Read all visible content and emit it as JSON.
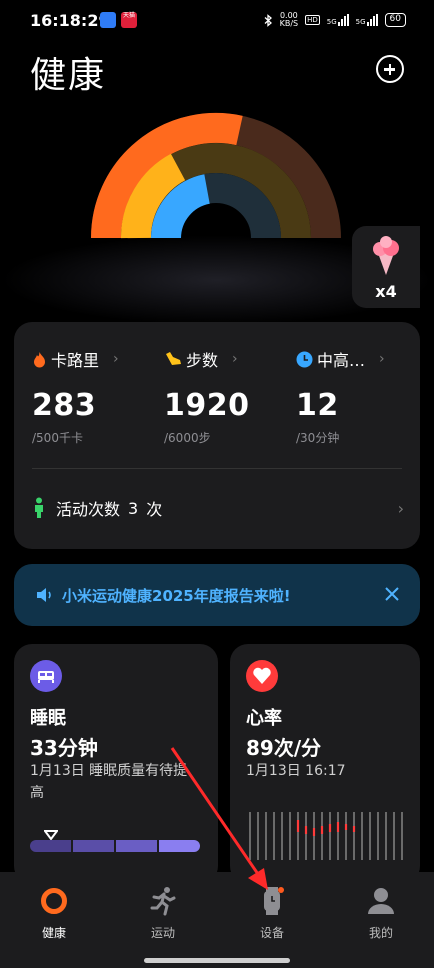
{
  "status_bar": {
    "time": "16:18:29",
    "net_speed_value": "0.00",
    "net_speed_unit": "KB/S",
    "hd_label": "HD",
    "signal_label_1": "5G",
    "signal_label_2": "5G",
    "battery": "60",
    "app2_badge": "天猫"
  },
  "header": {
    "title": "健康"
  },
  "activity_badge": {
    "count": "x4"
  },
  "summary": {
    "metrics": [
      {
        "label": "卡路里",
        "value": "283",
        "target": "/500千卡",
        "icon": "flame-icon",
        "color": "#ff6a1e"
      },
      {
        "label": "步数",
        "value": "1920",
        "target": "/6000步",
        "icon": "shoe-icon",
        "color": "#ffc21a"
      },
      {
        "label": "中高…",
        "value": "12",
        "target": "/30分钟",
        "icon": "clock-icon",
        "color": "#38a7ff"
      }
    ],
    "activity": {
      "label": "活动次数",
      "count": "3",
      "unit": "次"
    }
  },
  "banner": {
    "text": "小米运动健康2025年度报告来啦!",
    "icon": "speaker-icon",
    "color": "#4fb3ff"
  },
  "sleep": {
    "title": "睡眠",
    "value": "33分钟",
    "subtitle": "1月13日 睡眠质量有待提高",
    "icon": "bed-icon",
    "color": "#6c5ce7"
  },
  "heart_rate": {
    "title": "心率",
    "value": "89次/分",
    "subtitle": "1月13日 16:17",
    "icon": "heart-icon",
    "color": "#ff3b3b"
  },
  "nav": {
    "items": [
      {
        "label": "健康",
        "icon": "ring-icon",
        "active": true
      },
      {
        "label": "运动",
        "icon": "runner-icon"
      },
      {
        "label": "设备",
        "icon": "watch-icon"
      },
      {
        "label": "我的",
        "icon": "profile-icon"
      }
    ]
  },
  "colors": {
    "calorie": "#ff6a1e",
    "steps": "#ffb21a",
    "intensity": "#38a7ff",
    "card": "#1c1c1e"
  }
}
